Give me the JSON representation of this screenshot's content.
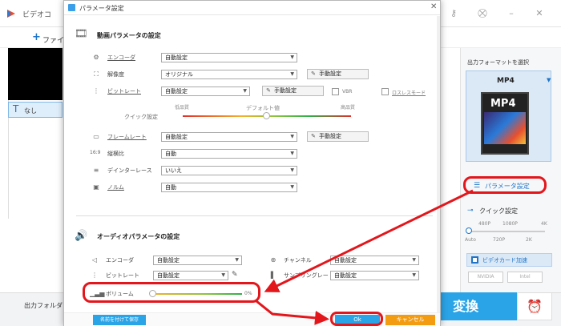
{
  "app": {
    "title": "ビデオコ",
    "add_label": "ファイ",
    "none_label": "なし",
    "output_folder_label": "出力フォルダ："
  },
  "right_panel": {
    "title": "出力フォーマットを選択",
    "format_name": "MP4",
    "format_icon_label": "MP4",
    "param_button_label": "パラメータ設定",
    "quick_title": "クイック設定",
    "quick_top_ticks": [
      "480P",
      "1080P",
      "4K"
    ],
    "quick_bottom_ticks": [
      "Auto",
      "720P",
      "2K"
    ],
    "gpu_label": "ビデオカード加速",
    "gpu_badges": [
      "NVIDIA",
      "Intel"
    ],
    "convert_label": "変換",
    "accent_color": "#2aa4e6"
  },
  "dialog": {
    "title": "パラメータ設定",
    "video_section": {
      "title": "動画パラメータの設定",
      "rows": [
        {
          "icon": "encoder-icon",
          "label": "エンコーダ",
          "value": "自動設定"
        },
        {
          "icon": "resolution-icon",
          "label": "解像度",
          "value": "オリジナル",
          "button": "手動設定"
        },
        {
          "icon": "bitrate-icon",
          "label": "ビットレート",
          "value": "自動設定",
          "button": "手動設定"
        },
        {
          "icon": "framerate-icon",
          "label": "フレームレート",
          "value": "自動設定",
          "button": "手動設定"
        },
        {
          "icon": "aspect-icon",
          "label": "縦横比",
          "value": "自動"
        },
        {
          "icon": "deinterlace-icon",
          "label": "デインターレース",
          "value": "いいえ"
        },
        {
          "icon": "norm-icon",
          "label": "ノルム",
          "value": "自動"
        }
      ],
      "vbr_label": "VBR",
      "lossless_label": "ロスレスモード",
      "quick_label": "クイック設定",
      "low_quality_label": "低品質",
      "default_label": "デフォルト値",
      "high_quality_label": "高品質"
    },
    "audio_section": {
      "title": "オーディオパラメータの設定",
      "encoder_label": "エンコーダ",
      "encoder_value": "自動設定",
      "bitrate_label": "ビットレート",
      "bitrate_value": "自動設定",
      "channel_label": "チャンネル",
      "channel_value": "自動設定",
      "sample_label": "サンプリングレート",
      "sample_value": "自動設定",
      "volume_label": "ボリューム",
      "volume_value": "0%"
    },
    "save_as_label": "名前を付けて保存",
    "ok_label": "Ok",
    "cancel_label": "キャンセル"
  }
}
